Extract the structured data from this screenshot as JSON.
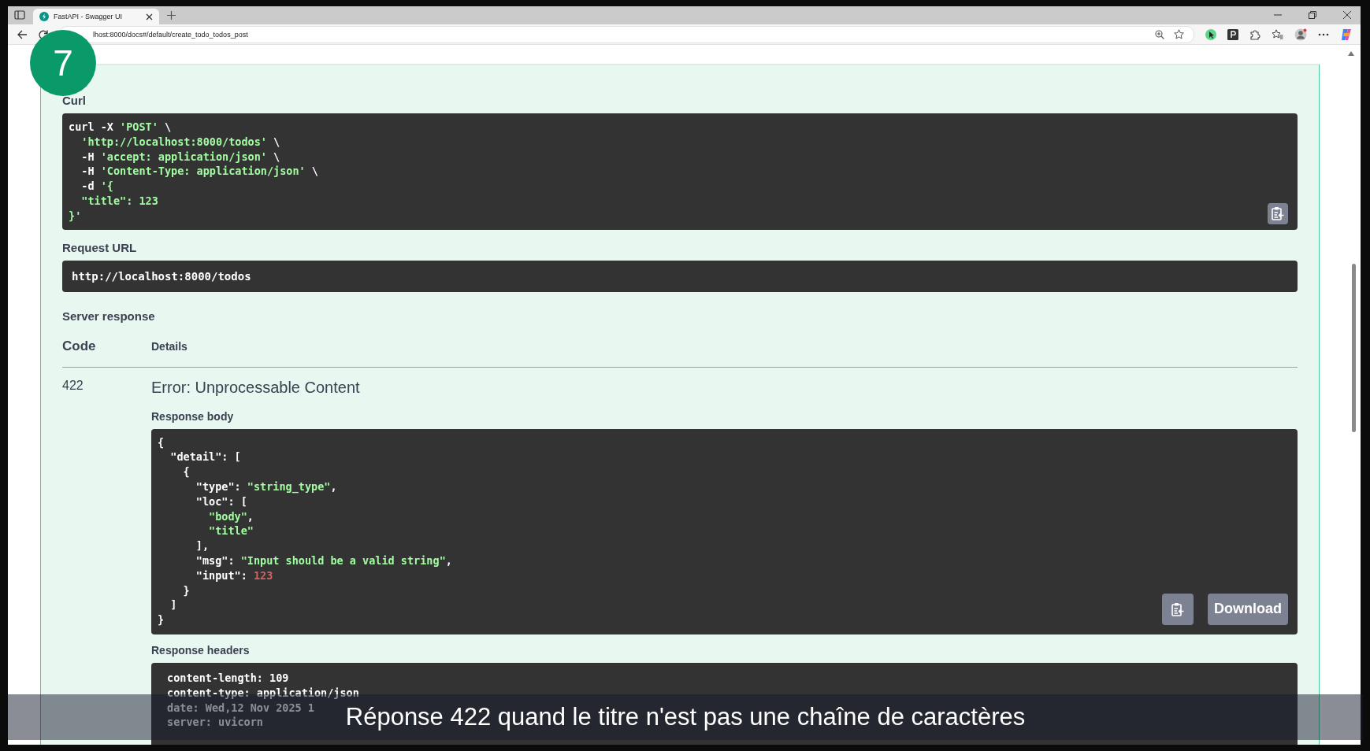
{
  "browser": {
    "tab_title": "FastAPI - Swagger UI",
    "address": "lhost:8000/docs#/default/create_todo_todos_post"
  },
  "step_badge": "7",
  "curl": {
    "label": "Curl",
    "lines": [
      [
        {
          "text": "curl -X ",
          "kind": "plain"
        },
        {
          "text": "'POST'",
          "kind": "string"
        },
        {
          "text": " \\",
          "kind": "plain"
        }
      ],
      [
        {
          "text": "  'http://localhost:8000/todos'",
          "kind": "string"
        },
        {
          "text": " \\",
          "kind": "plain"
        }
      ],
      [
        {
          "text": "  -H ",
          "kind": "plain"
        },
        {
          "text": "'accept: application/json'",
          "kind": "string"
        },
        {
          "text": " \\",
          "kind": "plain"
        }
      ],
      [
        {
          "text": "  -H ",
          "kind": "plain"
        },
        {
          "text": "'Content-Type: application/json'",
          "kind": "string"
        },
        {
          "text": " \\",
          "kind": "plain"
        }
      ],
      [
        {
          "text": "  -d ",
          "kind": "plain"
        },
        {
          "text": "'{",
          "kind": "string"
        }
      ],
      [
        {
          "text": "  \"title\": 123",
          "kind": "string"
        }
      ],
      [
        {
          "text": "}'",
          "kind": "string"
        }
      ]
    ]
  },
  "request_url": {
    "label": "Request URL",
    "value": "http://localhost:8000/todos"
  },
  "server_response": {
    "label": "Server response",
    "columns": [
      "Code",
      "Details"
    ],
    "code": "422",
    "status": "Error: Unprocessable Content",
    "body_label": "Response body",
    "body_lines": [
      [
        {
          "text": "{",
          "kind": "plain"
        }
      ],
      [
        {
          "text": "  \"detail\": [",
          "kind": "plain"
        }
      ],
      [
        {
          "text": "    {",
          "kind": "plain"
        }
      ],
      [
        {
          "text": "      \"type\": ",
          "kind": "plain"
        },
        {
          "text": "\"string_type\"",
          "kind": "string"
        },
        {
          "text": ",",
          "kind": "plain"
        }
      ],
      [
        {
          "text": "      \"loc\": [",
          "kind": "plain"
        }
      ],
      [
        {
          "text": "        \"body\"",
          "kind": "string"
        },
        {
          "text": ",",
          "kind": "plain"
        }
      ],
      [
        {
          "text": "        \"title\"",
          "kind": "string"
        }
      ],
      [
        {
          "text": "      ],",
          "kind": "plain"
        }
      ],
      [
        {
          "text": "      \"msg\": ",
          "kind": "plain"
        },
        {
          "text": "\"Input should be a valid string\"",
          "kind": "string"
        },
        {
          "text": ",",
          "kind": "plain"
        }
      ],
      [
        {
          "text": "      \"input\": ",
          "kind": "plain"
        },
        {
          "text": "123",
          "kind": "number"
        }
      ],
      [
        {
          "text": "    }",
          "kind": "plain"
        }
      ],
      [
        {
          "text": "  ]",
          "kind": "plain"
        }
      ],
      [
        {
          "text": "}",
          "kind": "plain"
        }
      ]
    ],
    "download": "Download",
    "headers_label": "Response headers",
    "header_lines": [
      "content-length: 109",
      "content-type: application/json",
      "date: Wed,12 Nov 2025 1",
      "server: uvicorn"
    ]
  },
  "subtitle": "Réponse 422 quand le titre n'est pas une chaîne de caractères"
}
